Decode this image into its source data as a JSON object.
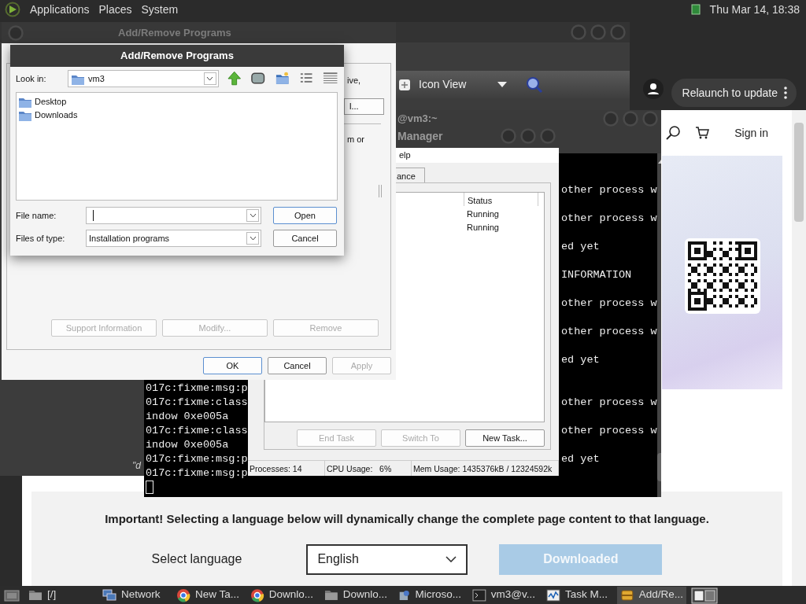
{
  "top_panel": {
    "menus": [
      "Applications",
      "Places",
      "System"
    ],
    "clock": "Thu Mar 14, 18:38"
  },
  "browser": {
    "update_button": "Relaunch to update",
    "sign_in": "Sign in",
    "notice": "Important! Selecting a language below will dynamically change the complete page content to that language.",
    "language_label": "Select language",
    "language": "English",
    "download_button": {
      "label": "Downloaded",
      "disabled": true
    }
  },
  "file_manager": {
    "view_mode": "Icon View",
    "status_fragment": "\"d"
  },
  "terminal": {
    "title": "@vm3:~",
    "lines": [
      {
        "kind": "text",
        "right": "other process w"
      },
      {
        "kind": "blank"
      },
      {
        "kind": "text",
        "right": "other process w"
      },
      {
        "kind": "blank"
      },
      {
        "kind": "text",
        "right": "ed yet"
      },
      {
        "kind": "blank"
      },
      {
        "kind": "text",
        "right": "INFORMATION"
      },
      {
        "kind": "blank"
      },
      {
        "kind": "text",
        "right": "other process w"
      },
      {
        "kind": "blank"
      },
      {
        "kind": "text",
        "right": "other process w"
      },
      {
        "kind": "blank"
      },
      {
        "kind": "text",
        "right": "ed yet"
      },
      {
        "kind": "blank"
      },
      {
        "kind": "text",
        "left": "017c:fixme:msg:p"
      },
      {
        "kind": "text",
        "left": "017c:fixme:class",
        "right": "other process w"
      },
      {
        "kind": "text",
        "left": "indow 0xe005a"
      },
      {
        "kind": "text",
        "left": "017c:fixme:class",
        "right": "other process w"
      },
      {
        "kind": "text",
        "left": "indow 0xe005a"
      },
      {
        "kind": "text",
        "left": "017c:fixme:msg:p",
        "right": "ed yet"
      },
      {
        "kind": "text",
        "left": "017c:fixme:msg:p"
      },
      {
        "kind": "cursor"
      }
    ]
  },
  "task_manager": {
    "title": "Manager",
    "menu": [
      "elp"
    ],
    "tabs": [
      {
        "label": "ance",
        "selected": false
      }
    ],
    "columns": [
      "Status"
    ],
    "rows": [
      {
        "status": "Running"
      },
      {
        "status": "Running"
      }
    ],
    "buttons": [
      {
        "label": "End Task",
        "disabled": true
      },
      {
        "label": "Switch To",
        "disabled": true
      },
      {
        "label": "New Task...",
        "disabled": false
      }
    ],
    "status_bar": [
      "Processes: 14",
      "CPU Usage:   6%",
      "Mem Usage: 1435376kB / 12324592k"
    ]
  },
  "add_remove": {
    "title": "Add/Remove Programs",
    "fragments": [
      "ive,",
      "m or"
    ],
    "partial_button": "l...",
    "action_buttons": [
      {
        "label": "Support Information",
        "disabled": true
      },
      {
        "label": "Modify...",
        "disabled": true
      },
      {
        "label": "Remove",
        "disabled": true
      }
    ],
    "dialog_buttons": [
      {
        "label": "OK",
        "default": true,
        "disabled": false
      },
      {
        "label": "Cancel",
        "default": false,
        "disabled": false
      },
      {
        "label": "Apply",
        "default": false,
        "disabled": true
      }
    ]
  },
  "open_dialog": {
    "title": "Add/Remove Programs",
    "look_in_label": "Look in:",
    "look_in": "vm3",
    "items": [
      {
        "name": "Desktop"
      },
      {
        "name": "Downloads"
      }
    ],
    "file_name_label": "File name:",
    "file_type_label": "Files of type:",
    "file_type": "Installation programs",
    "buttons": [
      {
        "label": "Open",
        "default": true
      },
      {
        "label": "Cancel",
        "default": false
      }
    ]
  },
  "taskbar": {
    "items": [
      {
        "label": "[/]",
        "kind": "folder",
        "selected": false
      },
      {
        "label": "Network",
        "kind": "network",
        "selected": false
      },
      {
        "label": "New Ta...",
        "kind": "browser",
        "selected": false
      },
      {
        "label": "Downlo...",
        "kind": "browser",
        "selected": false
      },
      {
        "label": "Downlo...",
        "kind": "folder",
        "selected": false
      },
      {
        "label": "Microso...",
        "kind": "installer",
        "selected": false
      },
      {
        "label": "vm3@v...",
        "kind": "terminal",
        "selected": false
      },
      {
        "label": "Task M...",
        "kind": "monitor",
        "selected": false
      },
      {
        "label": "Add/Re...",
        "kind": "package",
        "selected": true
      }
    ]
  }
}
